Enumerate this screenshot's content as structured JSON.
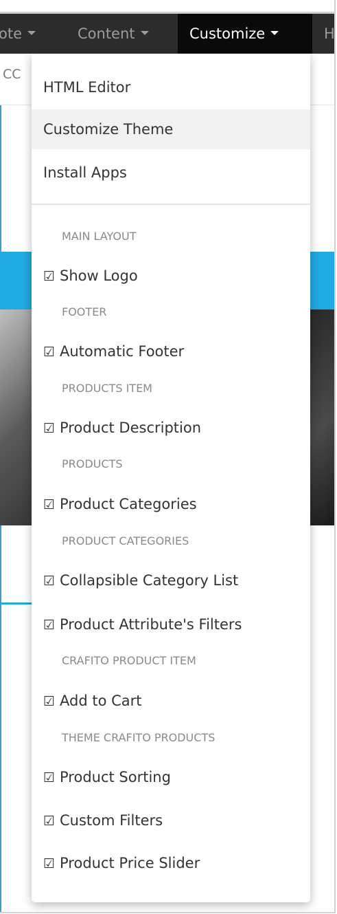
{
  "navbar": {
    "items": [
      {
        "label": "ote",
        "active": false
      },
      {
        "label": "Content",
        "active": false
      },
      {
        "label": "Customize",
        "active": true
      },
      {
        "label": "H",
        "active": false
      }
    ]
  },
  "subnav": {
    "text": "CC"
  },
  "dropdown": {
    "top_items": [
      {
        "label": "HTML Editor"
      },
      {
        "label": "Customize Theme"
      },
      {
        "label": "Install Apps"
      }
    ],
    "sections": [
      {
        "header": "MAIN LAYOUT",
        "items": [
          "Show Logo"
        ]
      },
      {
        "header": "FOOTER",
        "items": [
          "Automatic Footer"
        ]
      },
      {
        "header": "PRODUCTS ITEM",
        "items": [
          "Product Description"
        ]
      },
      {
        "header": "PRODUCTS",
        "items": [
          "Product Categories"
        ]
      },
      {
        "header": "PRODUCT CATEGORIES",
        "items": [
          "Collapsible Category List",
          "Product Attribute's Filters"
        ]
      },
      {
        "header": "CRAFITO PRODUCT ITEM",
        "items": [
          "Add to Cart"
        ]
      },
      {
        "header": "THEME CRAFITO PRODUCTS",
        "items": [
          "Product Sorting",
          "Custom Filters",
          "Product Price Slider"
        ]
      }
    ]
  },
  "icons": {
    "checkbox": "checked-checkbox-icon",
    "caret": "caret-down-icon"
  },
  "colors": {
    "navbar_bg": "#2c2c2c",
    "navbar_active_bg": "#0a0a0a",
    "accent": "#21a9e1"
  }
}
